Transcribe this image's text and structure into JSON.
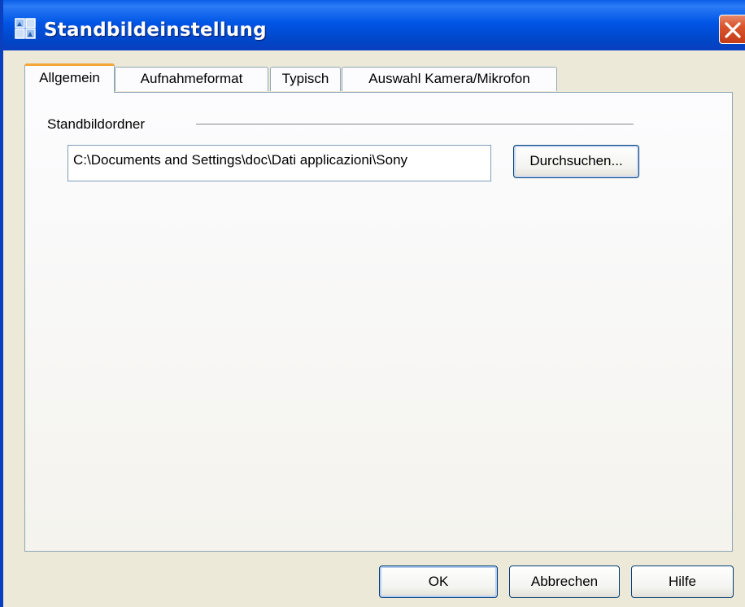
{
  "window": {
    "title": "Standbildeinstellung"
  },
  "icons": {
    "app": "app-icon",
    "close": "close-icon"
  },
  "tabs": [
    {
      "label": "Allgemein",
      "active": true
    },
    {
      "label": "Aufnahmeformat",
      "active": false
    },
    {
      "label": "Typisch",
      "active": false
    },
    {
      "label": "Auswahl Kamera/Mikrofon",
      "active": false
    }
  ],
  "general": {
    "group_label": "Standbildordner",
    "folder_path": "C:\\Documents and Settings\\doc\\Dati applicazioni\\Sony",
    "browse_label": "Durchsuchen..."
  },
  "footer": {
    "ok_label": "OK",
    "cancel_label": "Abbrechen",
    "help_label": "Hilfe"
  },
  "colors": {
    "titlebar": "#0055e5",
    "close": "#d9542d",
    "dialog_bg": "#ece9d8",
    "active_tab_accent": "#f3a63a"
  }
}
